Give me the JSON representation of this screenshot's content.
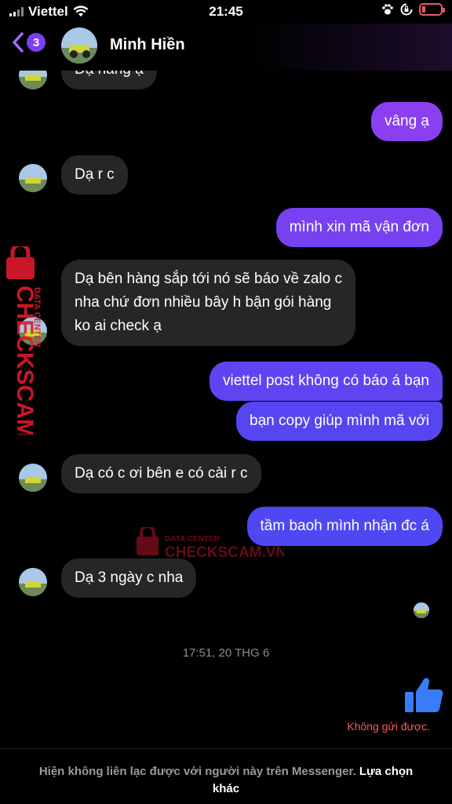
{
  "status_bar": {
    "carrier": "Viettel",
    "time": "21:45"
  },
  "header": {
    "unread_count": "3",
    "contact_name": "Minh Hiền"
  },
  "messages": [
    {
      "dir": "in",
      "text": "Dạ hàng ạ"
    },
    {
      "dir": "out",
      "text": "vâng ạ"
    },
    {
      "dir": "in",
      "text": "Dạ r c"
    },
    {
      "dir": "out",
      "text": "mình xin mã vận đơn"
    },
    {
      "dir": "in",
      "lines": [
        "Dạ bên hàng sắp tới nó sẽ báo về zalo c",
        "nha chứ đơn nhiều bây h bận gói hàng",
        "ko ai check ạ"
      ]
    },
    {
      "dir": "out",
      "text": "viettel post không có báo á bạn"
    },
    {
      "dir": "out",
      "text": "bạn copy giúp mình mã với"
    },
    {
      "dir": "in",
      "text": "Dạ có c ơi bên e có cài r c"
    },
    {
      "dir": "out",
      "text": "tầm baoh mình nhận đc á"
    },
    {
      "dir": "in",
      "text": "Dạ 3 ngày c nha"
    }
  ],
  "timestamp": "17:51, 20 THG 6",
  "send_error": "Không gửi được.",
  "footer": {
    "notice": "Hiện không liên lạc được với người này trên Messenger.",
    "link": "Lựa chọn khác"
  },
  "watermark": {
    "top_line": "DATA CENTER",
    "brand": "CHECKSCAM.VN"
  },
  "colors": {
    "outgoing_top": "#8a3ff0",
    "outgoing_bottom": "#5546f2",
    "incoming": "#262628",
    "like": "#3a7cf7",
    "error": "#ff5a5f",
    "watermark": "#e0192e"
  },
  "icons": [
    "wifi-icon",
    "paw-icon",
    "rotation-lock-icon",
    "battery-icon",
    "back-chevron-icon",
    "thumbs-up-icon",
    "lock-icon"
  ]
}
